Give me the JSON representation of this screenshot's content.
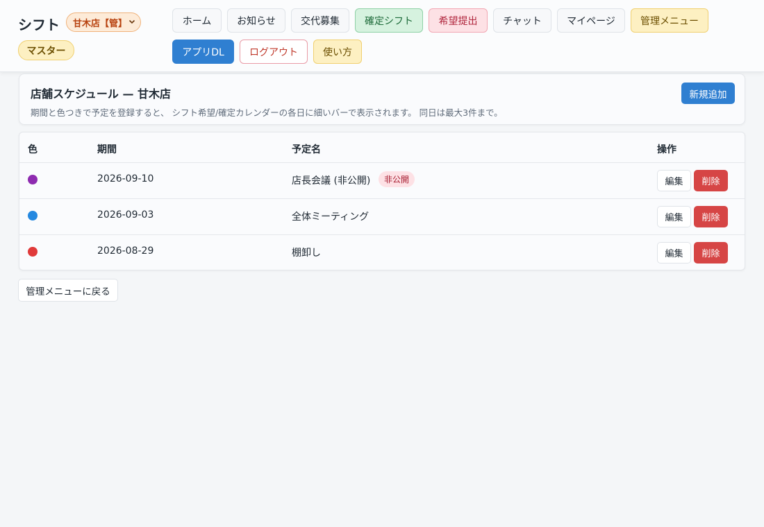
{
  "header": {
    "app_title": "シフト",
    "store_select": {
      "value": "甘木店【管】",
      "icon": "chevron-down-icon"
    },
    "role_badge": "マスター",
    "nav": {
      "home": "ホーム",
      "news": "お知らせ",
      "swap": "交代募集",
      "confirmed": "確定シフト",
      "request": "希望提出",
      "chat": "チャット",
      "mypage": "マイページ",
      "admin": "管理メニュー",
      "app_dl": "アプリDL",
      "logout": "ログアウト",
      "howto": "使い方"
    }
  },
  "schedule": {
    "title": "店舗スケジュール — 甘木店",
    "description": "期間と色つきで予定を登録すると、 シフト希望/確定カレンダーの各日に細いバーで表示されます。 同日は最大3件まで。",
    "add_button": "新規追加"
  },
  "table": {
    "headers": {
      "color": "色",
      "period": "期間",
      "name": "予定名",
      "actions": "操作"
    },
    "rows": [
      {
        "color": "#8e2bb0",
        "period": "2026-09-10",
        "name": "店長会議 (非公開)",
        "badge": "非公開",
        "edit": "編集",
        "delete": "削除"
      },
      {
        "color": "#2488e0",
        "period": "2026-09-03",
        "name": "全体ミーティング",
        "edit": "編集",
        "delete": "削除"
      },
      {
        "color": "#e03a3a",
        "period": "2026-08-29",
        "name": "棚卸し",
        "edit": "編集",
        "delete": "削除"
      }
    ]
  },
  "back_button": "管理メニューに戻る",
  "colors": {
    "primary": "#2f7fd1",
    "danger": "#d64545"
  }
}
